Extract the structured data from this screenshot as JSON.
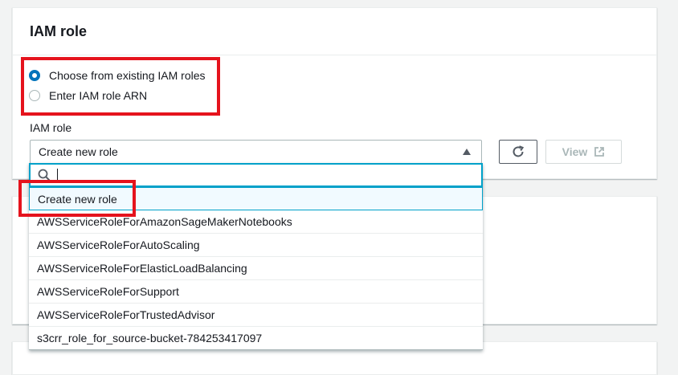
{
  "panel": {
    "title": "IAM role"
  },
  "radio_group": {
    "options": [
      {
        "label": "Choose from existing IAM roles",
        "selected": true
      },
      {
        "label": "Enter IAM role ARN",
        "selected": false
      }
    ]
  },
  "iam_role": {
    "label": "IAM role",
    "selected_value": "Create new role"
  },
  "buttons": {
    "view_label": "View",
    "refresh_icon": "refresh-icon",
    "external_icon": "external-link-icon"
  },
  "dropdown": {
    "search_value": "",
    "search_icon": "search-icon",
    "options": [
      "Create new role",
      "AWSServiceRoleForAmazonSageMakerNotebooks",
      "AWSServiceRoleForAutoScaling",
      "AWSServiceRoleForElasticLoadBalancing",
      "AWSServiceRoleForSupport",
      "AWSServiceRoleForTrustedAdvisor",
      "s3crr_role_for_source-bucket-784253417097"
    ]
  },
  "colors": {
    "accent": "#0073bb",
    "focus": "#00a1c9",
    "annotation_red": "#e5131d"
  }
}
